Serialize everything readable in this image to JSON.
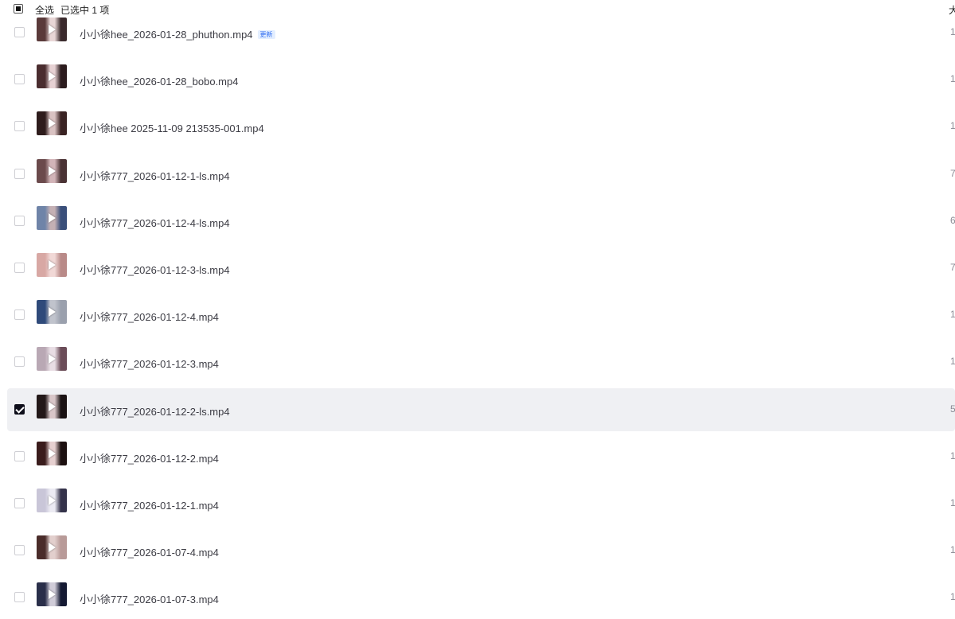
{
  "header": {
    "select_all": "全选",
    "selected_count": "已选中 1 项",
    "size_col": "大"
  },
  "rows": [
    {
      "name": "小小徐hee_2026-01-28_phuthon.mp4",
      "badge": "更新",
      "size": "1",
      "selected": false,
      "thumb": [
        "#5a3a3a",
        "#e8d6d6",
        "#3a2a2c"
      ]
    },
    {
      "name": "小小徐hee_2026-01-28_bobo.mp4",
      "badge": "",
      "size": "1",
      "selected": false,
      "thumb": [
        "#4a2d2f",
        "#e6d1d3",
        "#2c1c1e"
      ]
    },
    {
      "name": "小小徐hee 2025-11-09 213535-001.mp4",
      "badge": "",
      "size": "1",
      "selected": false,
      "thumb": [
        "#2e1c1c",
        "#d9c2c2",
        "#3a2323"
      ]
    },
    {
      "name": "小小徐777_2026-01-12-1-ls.mp4",
      "badge": "",
      "size": "7",
      "selected": false,
      "thumb": [
        "#6b4a4c",
        "#d2b4b8",
        "#4a3234"
      ]
    },
    {
      "name": "小小徐777_2026-01-12-4-ls.mp4",
      "badge": "",
      "size": "6",
      "selected": false,
      "thumb": [
        "#6f84a8",
        "#c4b0b4",
        "#3a4f7a"
      ]
    },
    {
      "name": "小小徐777_2026-01-12-3-ls.mp4",
      "badge": "",
      "size": "7",
      "selected": false,
      "thumb": [
        "#d8a8a4",
        "#f1d8d6",
        "#b98a88"
      ]
    },
    {
      "name": "小小徐777_2026-01-12-4.mp4",
      "badge": "",
      "size": "1",
      "selected": false,
      "thumb": [
        "#2f4a7a",
        "#c0c3cc",
        "#9aa0ad"
      ]
    },
    {
      "name": "小小徐777_2026-01-12-3.mp4",
      "badge": "",
      "size": "1",
      "selected": false,
      "thumb": [
        "#b9a8b4",
        "#e8dde4",
        "#6b4c58"
      ]
    },
    {
      "name": "小小徐777_2026-01-12-2-ls.mp4",
      "badge": "",
      "size": "5",
      "selected": true,
      "thumb": [
        "#221818",
        "#d8c6c8",
        "#1a1213"
      ]
    },
    {
      "name": "小小徐777_2026-01-12-2.mp4",
      "badge": "",
      "size": "1",
      "selected": false,
      "thumb": [
        "#3a1c1c",
        "#e6d0d0",
        "#1c1010"
      ]
    },
    {
      "name": "小小徐777_2026-01-12-1.mp4",
      "badge": "",
      "size": "1",
      "selected": false,
      "thumb": [
        "#c9c6d8",
        "#ecebf3",
        "#34324a"
      ]
    },
    {
      "name": "小小徐777_2026-01-07-4.mp4",
      "badge": "",
      "size": "1",
      "selected": false,
      "thumb": [
        "#4a2c2a",
        "#e2cfcd",
        "#b89a98"
      ]
    },
    {
      "name": "小小徐777_2026-01-07-3.mp4",
      "badge": "",
      "size": "1",
      "selected": false,
      "thumb": [
        "#2a2f4a",
        "#d0ccd8",
        "#151a33"
      ]
    }
  ]
}
